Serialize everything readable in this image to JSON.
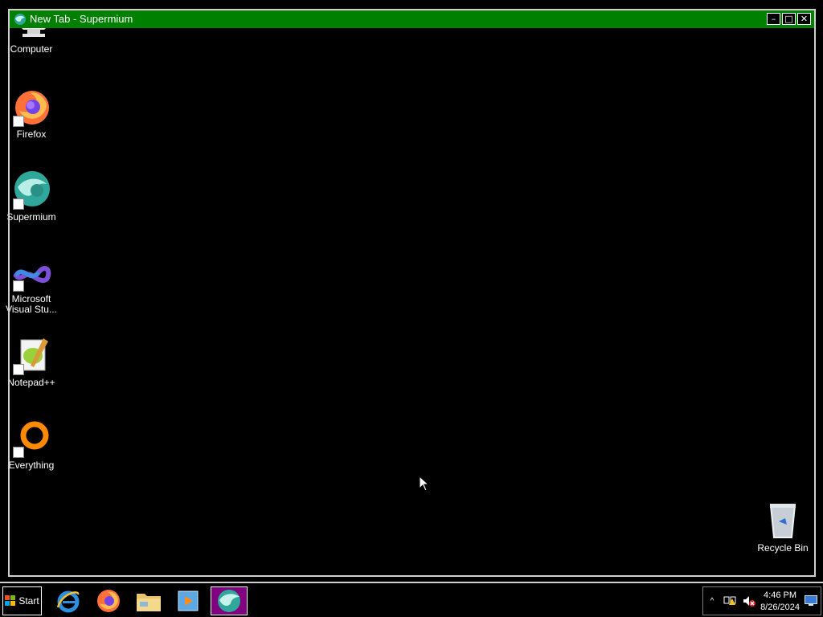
{
  "window": {
    "title": "New Tab - Supermium",
    "buttons": {
      "minimize": "–",
      "maximize": "□",
      "close": "✕"
    }
  },
  "desktop": {
    "icons": [
      {
        "label": "Computer",
        "icon": "computer-icon"
      },
      {
        "label": "Firefox",
        "icon": "firefox-icon"
      },
      {
        "label": "Supermium",
        "icon": "supermium-icon"
      },
      {
        "label": "Microsoft Visual Stu...",
        "icon": "visual-studio-icon"
      },
      {
        "label": "Notepad++",
        "icon": "notepadpp-icon"
      },
      {
        "label": "Everything",
        "icon": "everything-icon"
      },
      {
        "label": "Recycle Bin",
        "icon": "recycle-bin-icon"
      }
    ]
  },
  "taskbar": {
    "start_label": "Start",
    "apps": [
      {
        "name": "Internet Explorer",
        "icon": "ie-icon"
      },
      {
        "name": "Firefox",
        "icon": "firefox-icon"
      },
      {
        "name": "File Explorer",
        "icon": "folder-icon"
      },
      {
        "name": "Media Player",
        "icon": "media-player-icon"
      },
      {
        "name": "Supermium",
        "icon": "supermium-icon",
        "active": true
      }
    ],
    "tray": {
      "chevron": "^",
      "time": "4:46 PM",
      "date": "8/26/2024"
    }
  },
  "colors": {
    "titlebar": "#008000",
    "active_task": "#800080",
    "desktop": "#000000"
  }
}
